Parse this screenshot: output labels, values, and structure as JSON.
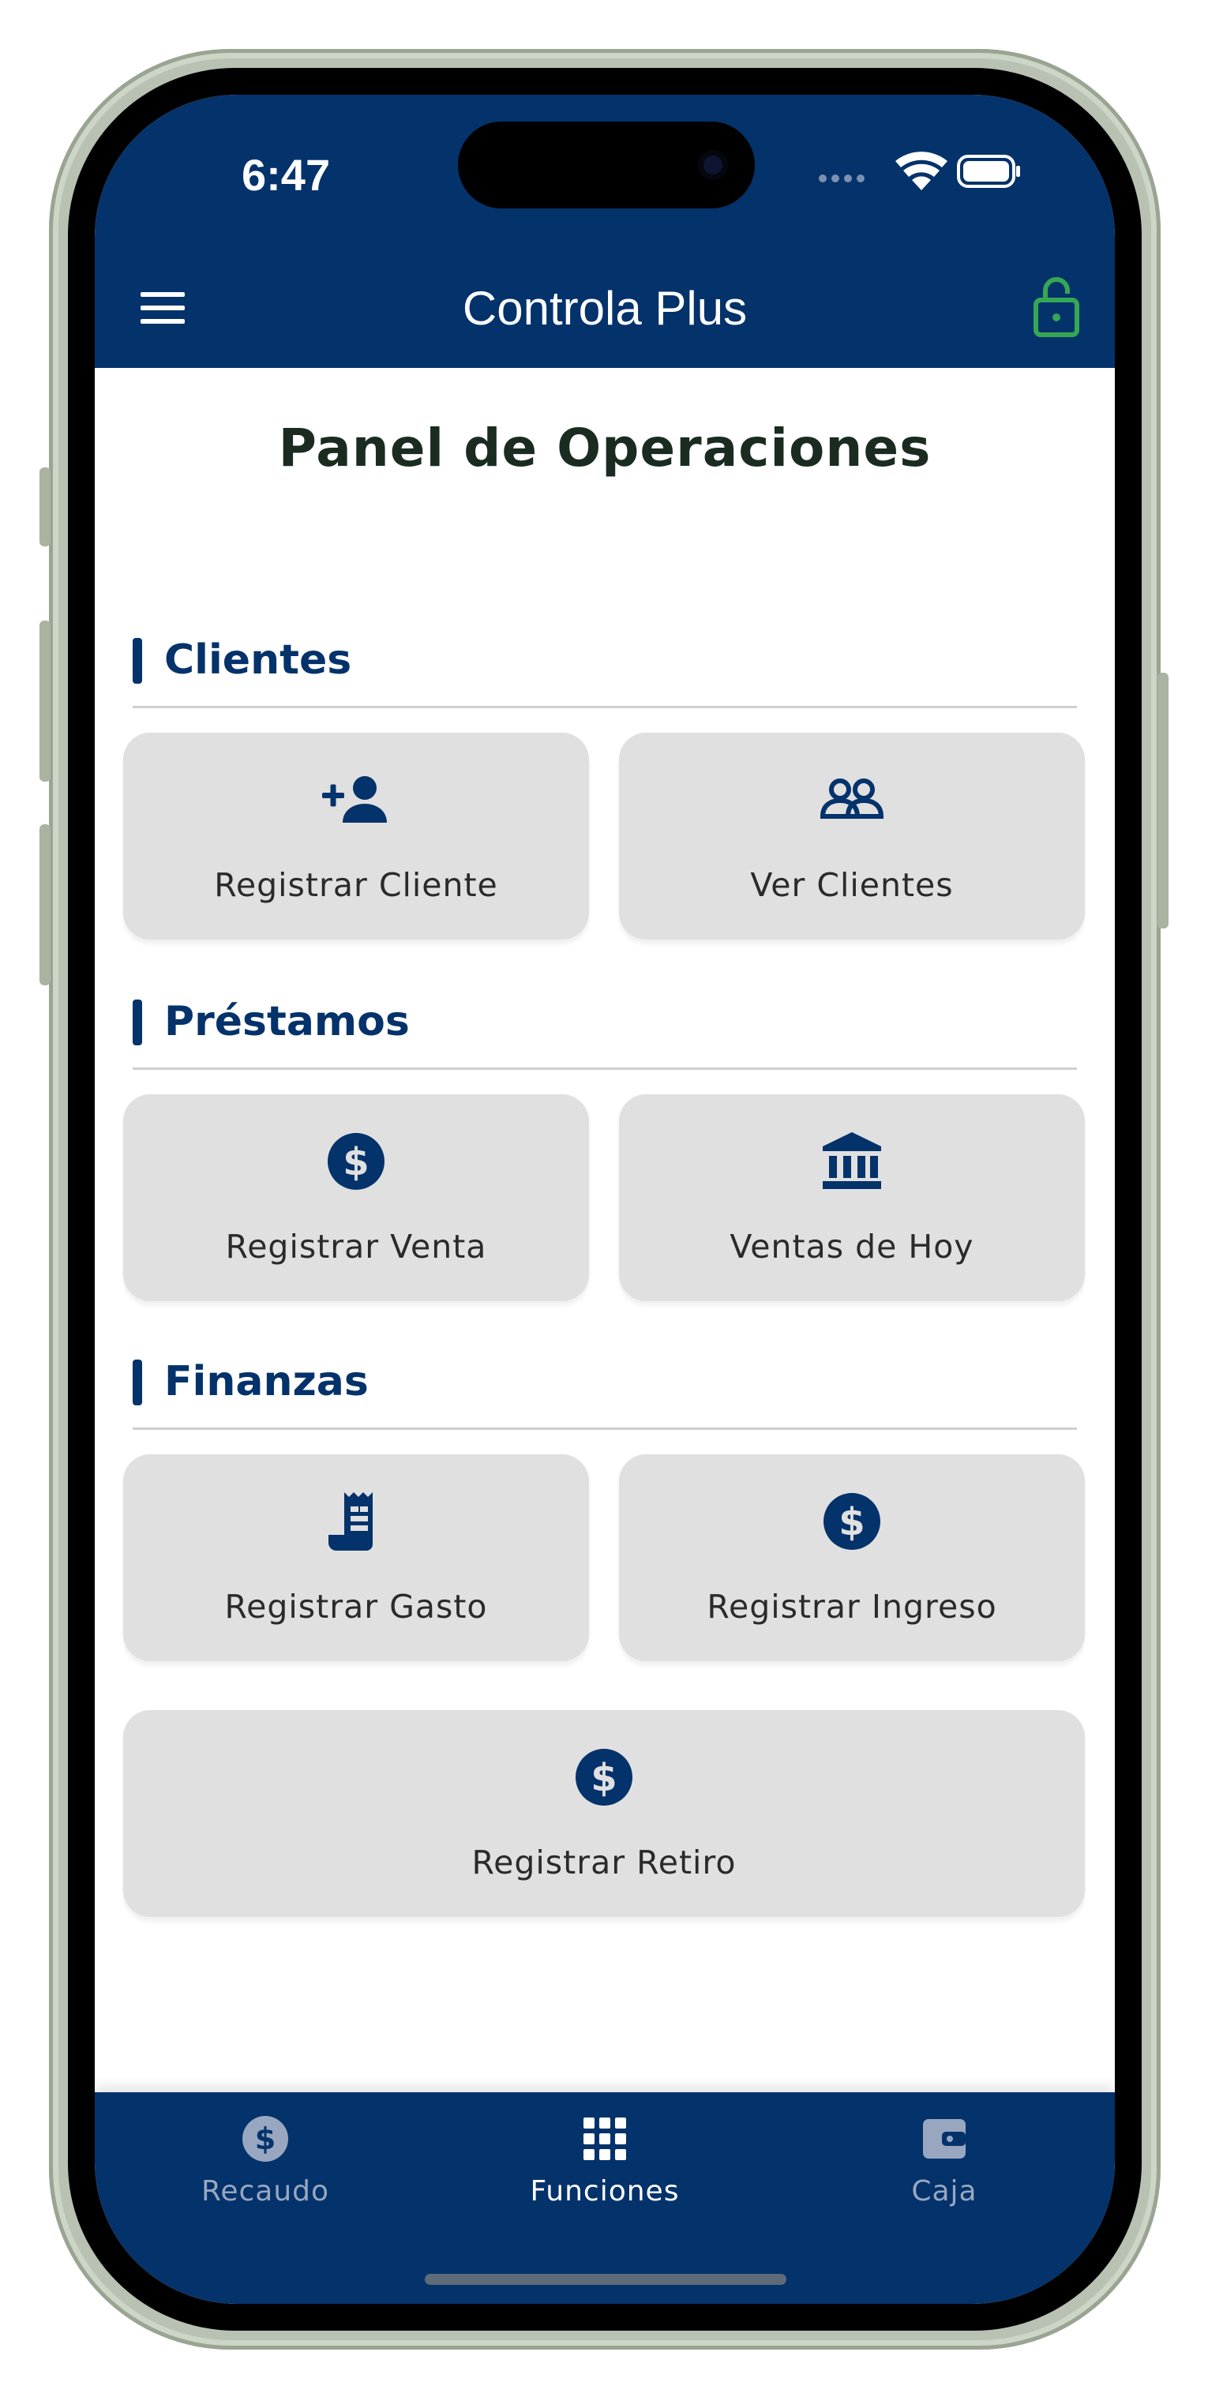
{
  "status_bar": {
    "time": "6:47"
  },
  "app_bar": {
    "title": "Controla Plus",
    "menu_icon": "hamburger-menu-icon",
    "lock_icon": "unlock-icon",
    "lock_color": "#34a853"
  },
  "colors": {
    "primary": "#04326b",
    "tile_background": "#e0e0e0",
    "page_title": "#1a2b20",
    "nav_inactive": "#98a7bf",
    "nav_active": "#ffffff"
  },
  "page": {
    "title": "Panel de Operaciones",
    "sections": [
      {
        "label": "Clientes",
        "tiles": [
          {
            "label": "Registrar Cliente",
            "icon": "person-add-icon"
          },
          {
            "label": "Ver Clientes",
            "icon": "people-icon"
          }
        ]
      },
      {
        "label": "Préstamos",
        "tiles": [
          {
            "label": "Registrar Venta",
            "icon": "dollar-circle-icon"
          },
          {
            "label": "Ventas de Hoy",
            "icon": "bank-icon"
          }
        ]
      },
      {
        "label": "Finanzas",
        "tiles": [
          {
            "label": "Registrar Gasto",
            "icon": "receipt-icon"
          },
          {
            "label": "Registrar Ingreso",
            "icon": "dollar-circle-icon"
          },
          {
            "label": "Registrar Retiro",
            "icon": "dollar-circle-icon"
          }
        ]
      }
    ]
  },
  "bottom_nav": {
    "items": [
      {
        "label": "Recaudo",
        "icon": "dollar-circle-icon",
        "active": false
      },
      {
        "label": "Funciones",
        "icon": "grid-icon",
        "active": true
      },
      {
        "label": "Caja",
        "icon": "wallet-icon",
        "active": false
      }
    ]
  }
}
